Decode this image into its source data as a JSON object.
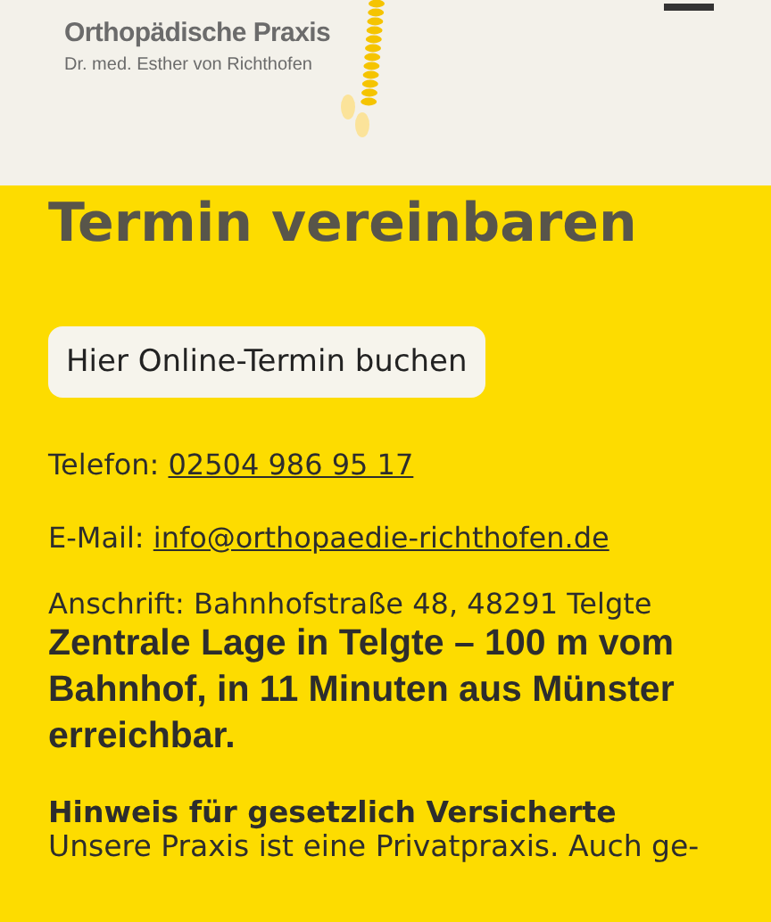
{
  "header": {
    "logo_title": "Orthopädische Praxis",
    "logo_subtitle": "Dr. med. Esther von Richthofen"
  },
  "section": {
    "heading": "Termin vereinbaren",
    "booking_button": "Hier Online-Termin buchen",
    "contacts": [
      {
        "label": "Telefon:",
        "link": "02504 986 95 17"
      },
      {
        "label": "E-Mail:",
        "link": "info@orthopaedie-richthofen.de"
      }
    ],
    "address": "Anschrift: Bahnhofstraße 48, 48291 Telgte",
    "highlight": "Zentrale Lage in Telgte – 100 m vom Bahnhof, in 11 Minuten aus Münster erreichbar.",
    "notice_title": "Hinweis für gesetzlich Versicherte",
    "notice_text": "Unsere Praxis ist eine Privatpraxis. Auch ge-"
  }
}
